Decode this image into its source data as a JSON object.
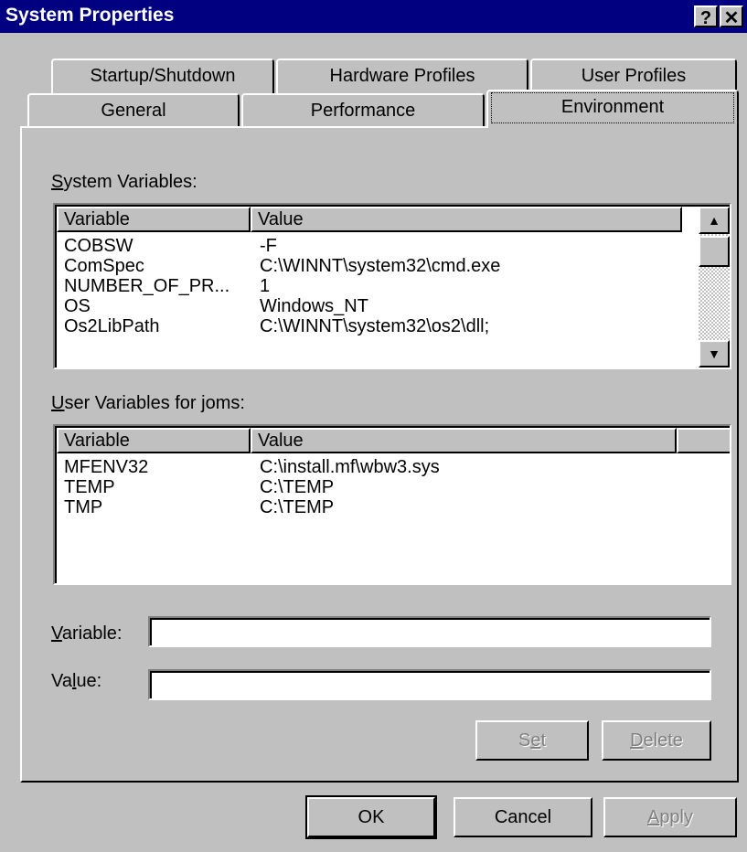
{
  "window": {
    "title": "System Properties",
    "help_glyph": "?",
    "close_glyph": "✕"
  },
  "tabs": {
    "back": [
      "Startup/Shutdown",
      "Hardware Profiles",
      "User Profiles"
    ],
    "front": [
      "General",
      "Performance",
      "Environment"
    ],
    "active": "Environment"
  },
  "system_vars": {
    "label_accel": "S",
    "label_rest": "ystem Variables:",
    "col_variable": "Variable",
    "col_value": "Value",
    "rows": [
      {
        "variable": "COBSW",
        "value": "-F"
      },
      {
        "variable": "ComSpec",
        "value": "C:\\WINNT\\system32\\cmd.exe"
      },
      {
        "variable": "NUMBER_OF_PR...",
        "value": "1"
      },
      {
        "variable": "OS",
        "value": "Windows_NT"
      },
      {
        "variable": "Os2LibPath",
        "value": "C:\\WINNT\\system32\\os2\\dll;"
      }
    ],
    "scroll_up_icon": "▲",
    "scroll_down_icon": "▼"
  },
  "user_vars": {
    "label_accel": "U",
    "label_rest": "ser Variables for joms:",
    "col_variable": "Variable",
    "col_value": "Value",
    "rows": [
      {
        "variable": "MFENV32",
        "value": "C:\\install.mf\\wbw3.sys"
      },
      {
        "variable": "TEMP",
        "value": "C:\\TEMP"
      },
      {
        "variable": "TMP",
        "value": "C:\\TEMP"
      }
    ]
  },
  "fields": {
    "variable_accel": "V",
    "variable_rest": "ariable:",
    "variable_value": "",
    "value_pre": "Va",
    "value_accel": "l",
    "value_rest": "ue:",
    "value_value": ""
  },
  "buttons": {
    "set_pre": "S",
    "set_accel": "e",
    "set_rest": "t",
    "delete_accel": "D",
    "delete_rest": "elete",
    "ok": "OK",
    "cancel": "Cancel",
    "apply_accel": "A",
    "apply_rest": "pply"
  }
}
